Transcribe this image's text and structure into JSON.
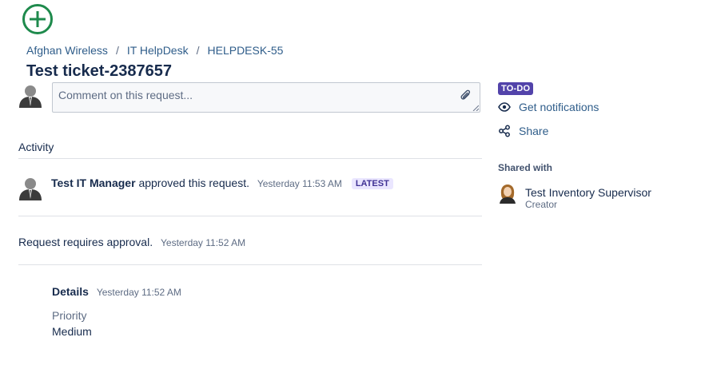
{
  "breadcrumbs": [
    "Afghan Wireless",
    "IT HelpDesk",
    "HELPDESK-55"
  ],
  "breadcrumb_separator": "/",
  "ticket_title": "Test ticket-2387657",
  "comment": {
    "placeholder": "Comment on this request...",
    "value": ""
  },
  "activity": {
    "title": "Activity",
    "entries": [
      {
        "user": "Test IT Manager",
        "action": "approved this request.",
        "timestamp": "Yesterday 11:53 AM",
        "badge": "LATEST"
      },
      {
        "text": "Request requires approval.",
        "timestamp": "Yesterday 11:52 AM"
      }
    ],
    "details": {
      "label": "Details",
      "timestamp": "Yesterday 11:52 AM",
      "field_label": "Priority",
      "field_value": "Medium"
    }
  },
  "sidebar": {
    "status": "TO-DO",
    "notifications_label": "Get notifications",
    "share_label": "Share",
    "shared_with_title": "Shared with",
    "shared_user": {
      "name": "Test Inventory Supervisor",
      "role": "Creator"
    }
  },
  "icons": {
    "logo": "plus-circle-icon",
    "attach": "paperclip-icon",
    "notifications": "eye-icon",
    "share": "share-icon"
  },
  "colors": {
    "logo_green": "#1e8a4c",
    "link": "#2f5d8a",
    "status_bg": "#5243aa",
    "latest_bg": "#eae6ff",
    "latest_text": "#403294"
  }
}
